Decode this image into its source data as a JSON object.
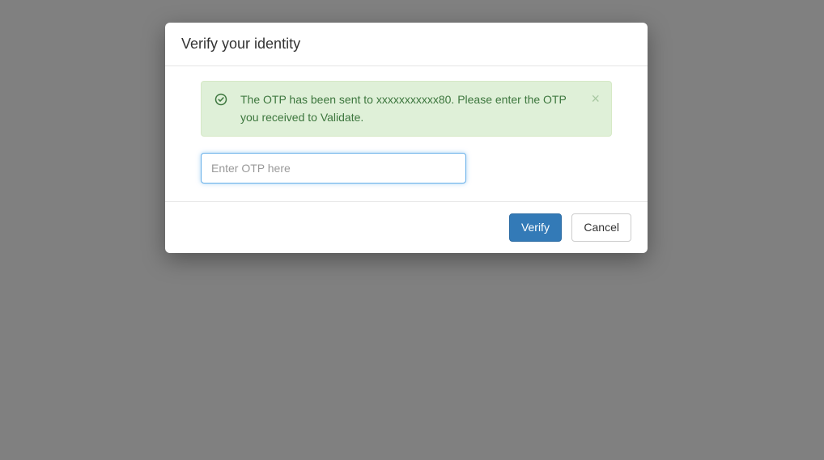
{
  "modal": {
    "title": "Verify your identity",
    "alert": {
      "message": "The OTP has been sent to xxxxxxxxxxx80. Please enter the OTP you received to Validate."
    },
    "otp": {
      "placeholder": "Enter OTP here",
      "value": ""
    },
    "buttons": {
      "verify": "Verify",
      "cancel": "Cancel"
    }
  }
}
